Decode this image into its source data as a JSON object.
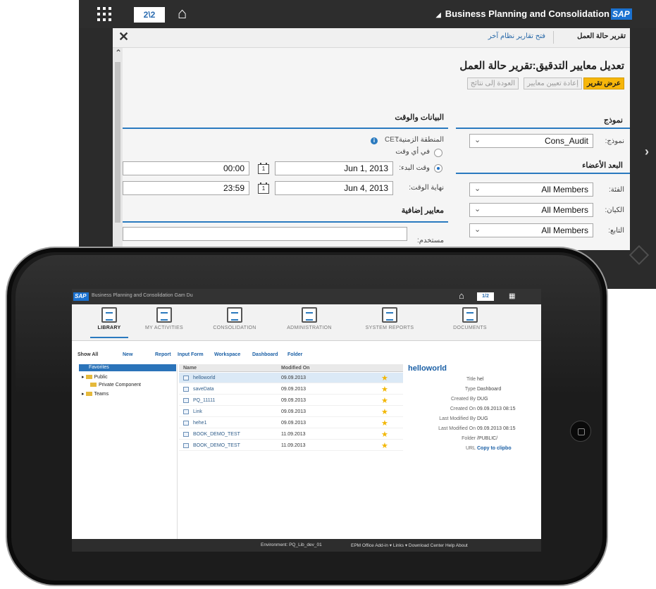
{
  "back_window": {
    "pager": "2\\2",
    "app_title": "Business Planning and Consolidation",
    "sap_logo": "SAP",
    "tabs": {
      "current": "تقرير حالة العمل",
      "open_other": "فتح تقارير نظام آخر"
    },
    "heading": "تعديل معايير التدقيق:تقرير حالة العمل",
    "buttons": {
      "view_report": "عرض تقرير",
      "reset": "إعادة تعيين معايير",
      "back": "العودة إلى نتائج"
    },
    "model_section": {
      "title": "نموذج",
      "model_label": "نموذج:",
      "model_value": "Cons_Audit",
      "dims_title": "البعد الأعضاء",
      "dims": [
        {
          "label": "الفئة:",
          "value": "All Members"
        },
        {
          "label": "الكيان:",
          "value": "All Members"
        },
        {
          "label": "التابع:",
          "value": "All Members"
        }
      ]
    },
    "datetime_section": {
      "title": "البيانات والوقت",
      "timezone_label": "المنطقة الزمنية:",
      "timezone_value": "CET",
      "anytime_label": "في أي وقت",
      "start_label": "وقت البدء:",
      "start_date": "Jun 1, 2013",
      "start_time": "00:00",
      "end_label": "نهاية الوقت:",
      "end_date": "Jun 4, 2013",
      "end_time": "23:59",
      "calendar_day": "1"
    },
    "extra_section": {
      "title": "معايير إضافية",
      "user_label": "مستخدم:"
    }
  },
  "tablet_app": {
    "sap_logo": "SAP",
    "title": "Business Planning and Consolidation  Gam Du",
    "pager": "1/2",
    "tabs": [
      "LIBRARY",
      "MY ACTIVITIES",
      "CONSOLIDATION",
      "ADMINISTRATION",
      "SYSTEM REPORTS",
      "DOCUMENTS"
    ],
    "toolbar": [
      "Show All",
      "New",
      "Report",
      "Input Form",
      "Workspace",
      "Dashboard",
      "Folder"
    ],
    "tree": [
      "Favorites",
      "Public",
      "Private Component",
      "Teams"
    ],
    "columns": [
      "Name",
      "Modified On"
    ],
    "rows": [
      {
        "name": "helloworld",
        "date": "09.09.2013"
      },
      {
        "name": "saveData",
        "date": "09.09.2013"
      },
      {
        "name": "PQ_11111",
        "date": "09.09.2013"
      },
      {
        "name": "Link",
        "date": "09.09.2013"
      },
      {
        "name": "hehe1",
        "date": "09.09.2013"
      },
      {
        "name": "BOOK_DEMO_TEST",
        "date": "11.09.2013"
      },
      {
        "name": "BOOK_DEMO_TEST",
        "date": "11.09.2013"
      }
    ],
    "details": {
      "title": "helloworld",
      "fields": [
        {
          "k": "Title",
          "v": "hel"
        },
        {
          "k": "Type",
          "v": "Dashboard"
        },
        {
          "k": "Created By",
          "v": "DUG"
        },
        {
          "k": "Created On",
          "v": "09.09.2013 08:15"
        },
        {
          "k": "Last Modified By",
          "v": "DUG"
        },
        {
          "k": "Last Modified On",
          "v": "09.09.2013 08:15"
        },
        {
          "k": "Folder",
          "v": "/PUBLIC/"
        },
        {
          "k": "URL",
          "v": "Copy to clipbo"
        }
      ]
    },
    "status": {
      "environment": "Environment: PQ_Lib_dev_01",
      "links": "EPM Office Add-in  ▾  Links  ▾  Download Center  Help  About"
    }
  }
}
